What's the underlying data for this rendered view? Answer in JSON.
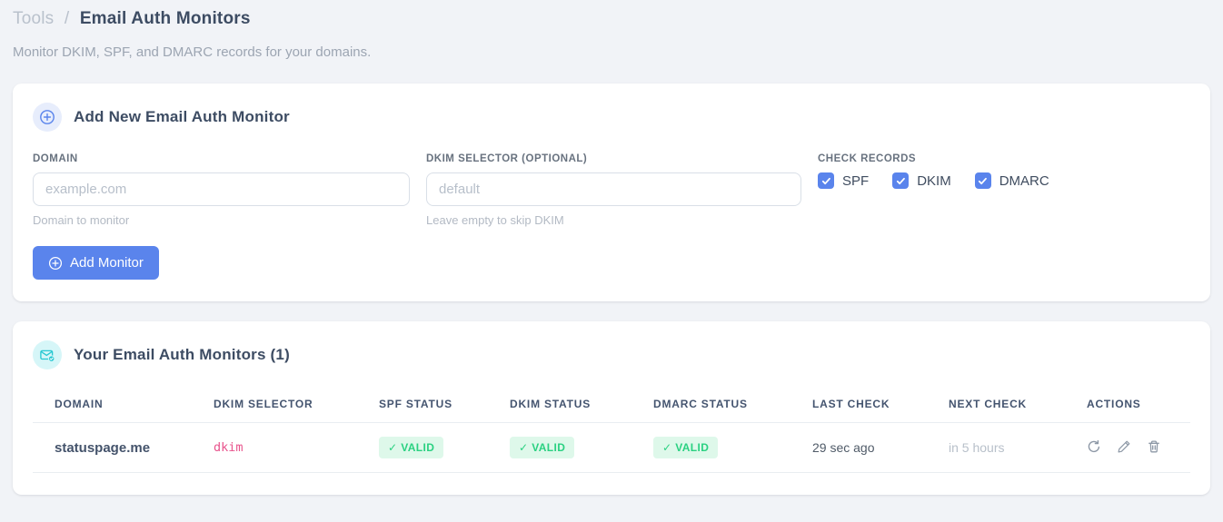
{
  "breadcrumb": {
    "parent": "Tools",
    "separator": "/",
    "current": "Email Auth Monitors"
  },
  "subtitle": "Monitor DKIM, SPF, and DMARC records for your domains.",
  "add_monitor_card": {
    "title": "Add New Email Auth Monitor",
    "domain_field": {
      "label": "DOMAIN",
      "placeholder": "example.com",
      "helper": "Domain to monitor"
    },
    "dkim_field": {
      "label": "DKIM SELECTOR (OPTIONAL)",
      "placeholder": "default",
      "helper": "Leave empty to skip DKIM"
    },
    "check_records": {
      "label": "CHECK RECORDS",
      "options": [
        {
          "label": "SPF",
          "checked": true
        },
        {
          "label": "DKIM",
          "checked": true
        },
        {
          "label": "DMARC",
          "checked": true
        }
      ]
    },
    "submit_button": "Add Monitor"
  },
  "monitors_card": {
    "title": "Your Email Auth Monitors (1)",
    "headers": [
      "DOMAIN",
      "DKIM SELECTOR",
      "SPF STATUS",
      "DKIM STATUS",
      "DMARC STATUS",
      "LAST CHECK",
      "NEXT CHECK",
      "ACTIONS"
    ],
    "rows": [
      {
        "domain": "statuspage.me",
        "dkim_selector": "dkim",
        "spf_status": "✓ VALID",
        "dkim_status": "✓ VALID",
        "dmarc_status": "✓ VALID",
        "last_check": "29 sec ago",
        "next_check": "in 5 hours",
        "actions": [
          "refresh-icon",
          "edit-icon",
          "delete-icon"
        ]
      }
    ]
  },
  "colors": {
    "accent_blue": "#5a84ec",
    "badge_green_text": "#2ad181",
    "badge_green_bg": "#def8ea",
    "selector_pink": "#e8538c",
    "teal_icon": "#27c8d2"
  }
}
